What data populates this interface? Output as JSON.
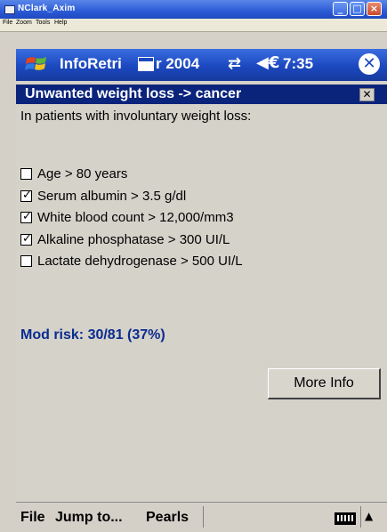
{
  "window": {
    "title": "NClark_Axim",
    "min_symbol": "_",
    "max_symbol": "□",
    "close_symbol": "×"
  },
  "emulator_menu": [
    "File",
    "Zoom",
    "Tools",
    "Help"
  ],
  "titlebar": {
    "app_title": "InfoRetri",
    "year_fragment": "r 2004",
    "connectivity_symbol": "⇄",
    "volume_symbol": "◀€",
    "time": "7:35",
    "ok_symbol": "✕"
  },
  "header": {
    "title": "Unwanted weight loss -> cancer",
    "close_symbol": "✕"
  },
  "intro": "In patients with involuntary weight loss:",
  "criteria": [
    {
      "label": "Age > 80 years",
      "checked": false
    },
    {
      "label": "Serum albumin > 3.5 g/dl",
      "checked": true
    },
    {
      "label": "White blood count > 12,000/mm3",
      "checked": true
    },
    {
      "label": "Alkaline phosphatase > 300 UI/L",
      "checked": true
    },
    {
      "label": "Lactate dehydrogenase > 500 UI/L",
      "checked": false
    }
  ],
  "check_symbol": "✓",
  "result": "Mod risk: 30/81 (37%)",
  "more_info_label": "More Info",
  "menubar": {
    "file": "File",
    "jump": "Jump to...",
    "pearls": "Pearls",
    "up_symbol": "▲"
  },
  "icons": [
    "windows-flag-icon",
    "calendar-icon",
    "connectivity-icon",
    "volume-icon",
    "keyboard-icon"
  ],
  "colors": {
    "titlebar": "#1c48bf",
    "header": "#0a237b",
    "result_text": "#0b2c8f"
  }
}
